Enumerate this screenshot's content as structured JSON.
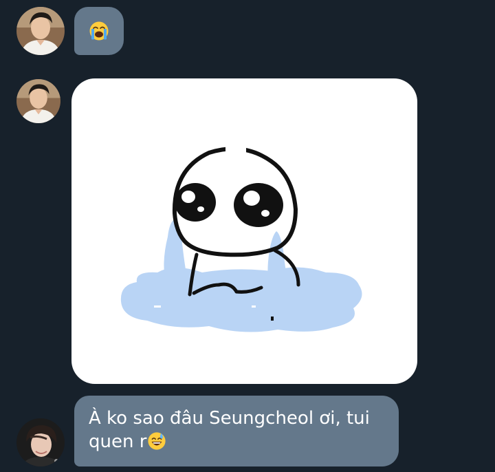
{
  "conversation": {
    "messages": [
      {
        "sender_avatar": "man-white-shirt-avatar",
        "type": "emoji",
        "emoji": "😭",
        "emoji_name": "loudly-crying-face-icon"
      },
      {
        "sender_avatar": "man-white-shirt-avatar",
        "type": "sticker",
        "sticker_name": "crying-blob-sticker"
      },
      {
        "sender_avatar": "man-dark-hair-avatar",
        "type": "text",
        "text_line1": "À ko sao đâu Seungcheol ơi, tui",
        "text_line2": "quen r",
        "trailing_emoji": "😅",
        "trailing_emoji_name": "grinning-sweat-icon"
      }
    ]
  },
  "colors": {
    "background": "#17212b",
    "bubble": "#64788b",
    "text": "#ffffff",
    "sticker_tears": "#b9d4f5"
  }
}
